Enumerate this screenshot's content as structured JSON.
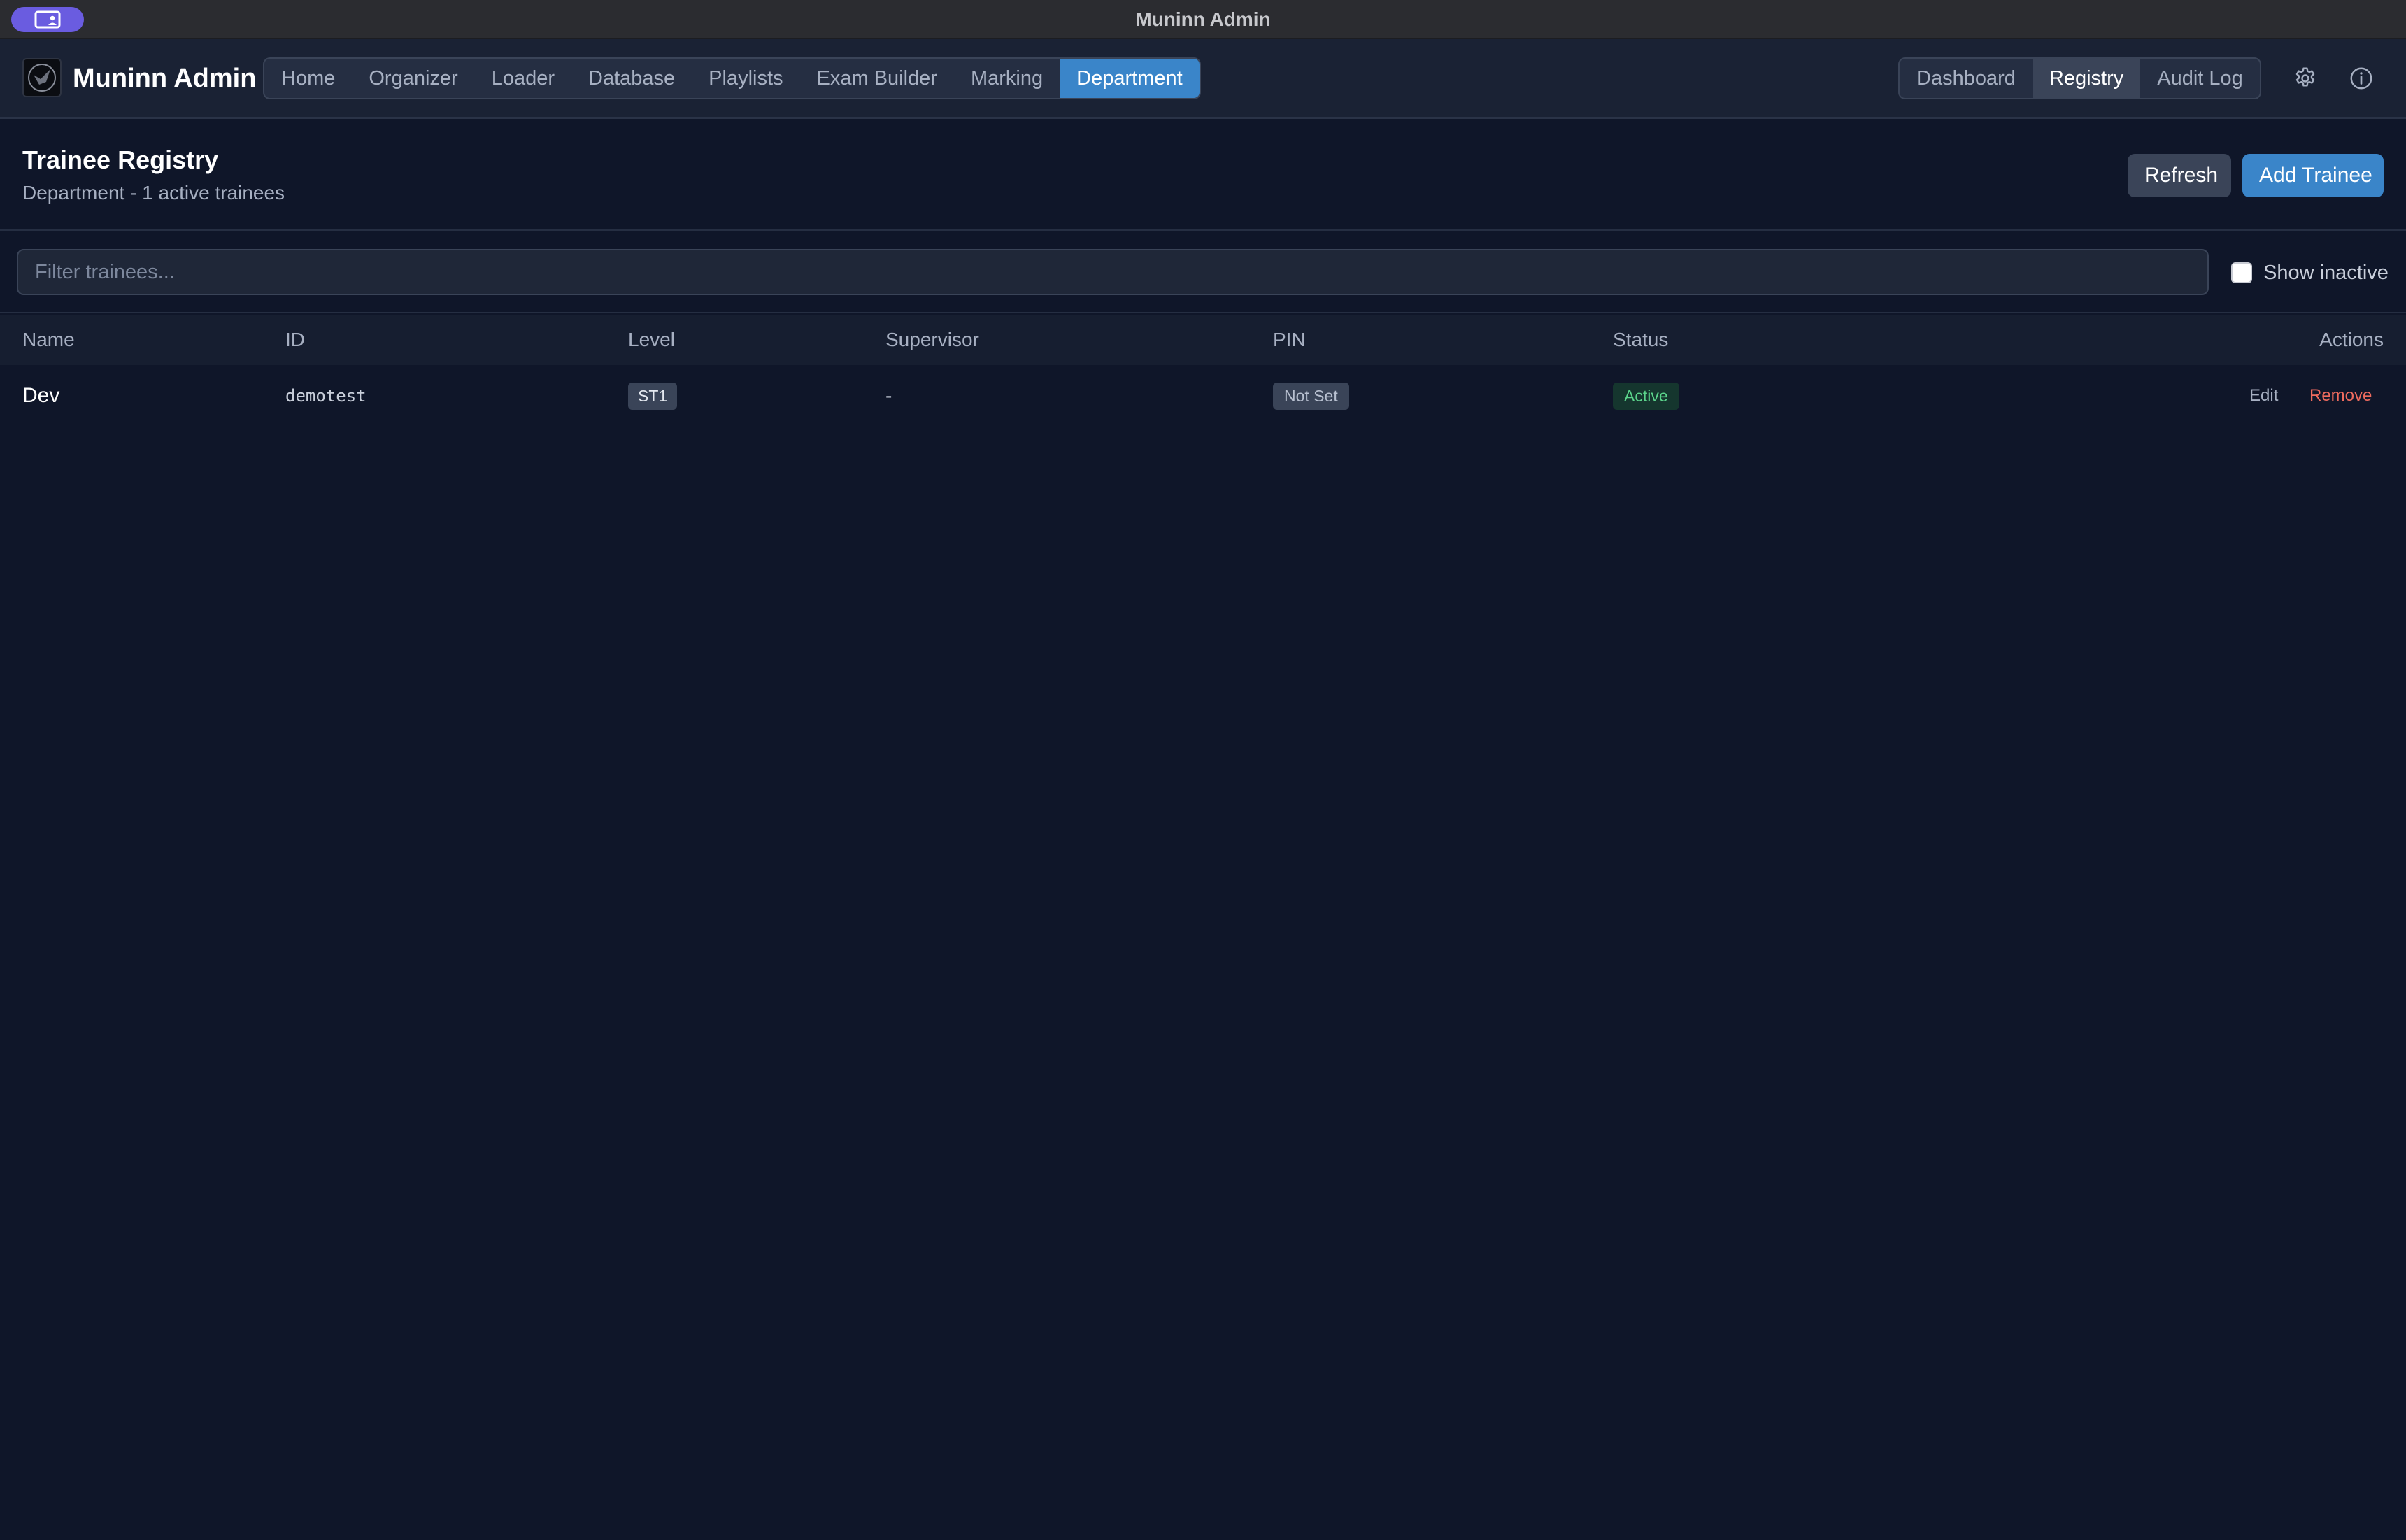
{
  "window": {
    "title": "Muninn Admin"
  },
  "app": {
    "name": "Muninn Admin",
    "nav_tabs": [
      {
        "label": "Home",
        "active": false
      },
      {
        "label": "Organizer",
        "active": false
      },
      {
        "label": "Loader",
        "active": false
      },
      {
        "label": "Database",
        "active": false
      },
      {
        "label": "Playlists",
        "active": false
      },
      {
        "label": "Exam Builder",
        "active": false
      },
      {
        "label": "Marking",
        "active": false
      },
      {
        "label": "Department",
        "active": true
      }
    ],
    "sub_tabs": [
      {
        "label": "Dashboard",
        "active": false
      },
      {
        "label": "Registry",
        "active": true
      },
      {
        "label": "Audit Log",
        "active": false
      }
    ],
    "icons": {
      "settings": "gear-icon",
      "info": "info-icon"
    }
  },
  "page": {
    "title": "Trainee Registry",
    "subtitle": "Department - 1 active trainees",
    "refresh_label": "Refresh",
    "add_label": "Add Trainee"
  },
  "filter": {
    "placeholder": "Filter trainees...",
    "value": "",
    "show_inactive_label": "Show inactive",
    "show_inactive_checked": false
  },
  "table": {
    "columns": {
      "name": "Name",
      "id": "ID",
      "level": "Level",
      "supervisor": "Supervisor",
      "pin": "PIN",
      "status": "Status",
      "actions": "Actions"
    },
    "rows": [
      {
        "name": "Dev",
        "id": "demotest",
        "level": "ST1",
        "supervisor": "-",
        "pin": "Not Set",
        "status": "Active",
        "edit_label": "Edit",
        "remove_label": "Remove"
      }
    ]
  },
  "colors": {
    "accent": "#3a85c9",
    "background": "#0f1629",
    "status_active": "#5bd48b",
    "danger": "#ef6b5e"
  }
}
